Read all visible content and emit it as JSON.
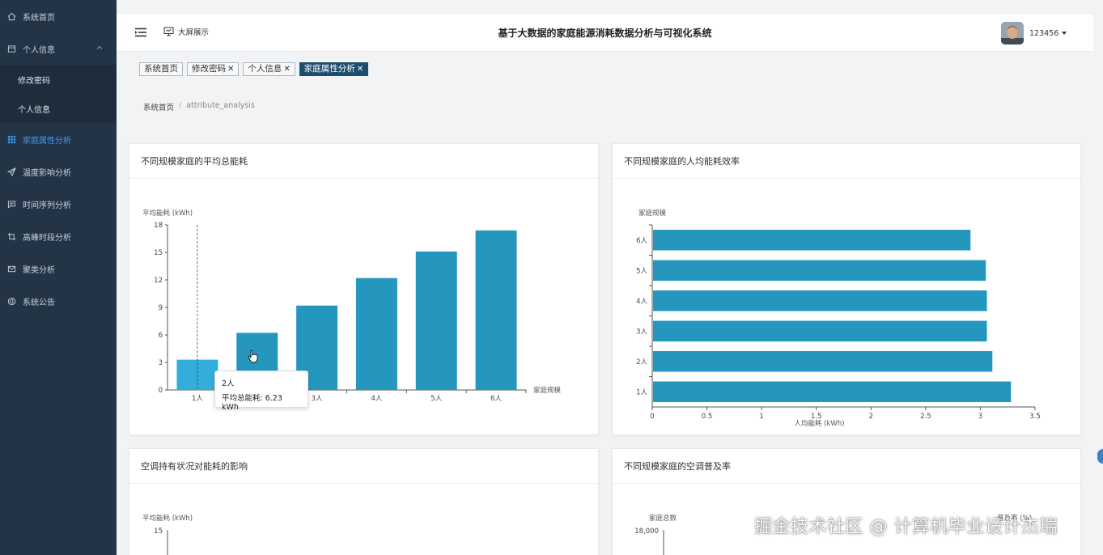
{
  "sidebar": {
    "items": [
      {
        "label": "系统首页",
        "icon": "home-icon"
      },
      {
        "label": "个人信息",
        "icon": "profile-icon",
        "expanded": true
      },
      {
        "label": "修改密码",
        "sub": true
      },
      {
        "label": "个人信息",
        "sub": true
      },
      {
        "label": "家庭属性分析",
        "icon": "grid-icon",
        "active": true
      },
      {
        "label": "温度影响分析",
        "icon": "send-icon"
      },
      {
        "label": "时间序列分析",
        "icon": "message-icon"
      },
      {
        "label": "高峰时段分析",
        "icon": "crop-icon"
      },
      {
        "label": "聚类分析",
        "icon": "mail-icon"
      },
      {
        "label": "系统公告",
        "icon": "announce-icon"
      }
    ]
  },
  "header": {
    "bigscreen_label": "大屏展示",
    "title": "基于大数据的家庭能源消耗数据分析与可视化系统",
    "username": "123456"
  },
  "tags": [
    {
      "label": "系统首页",
      "closable": false,
      "active": false
    },
    {
      "label": "修改密码",
      "closable": true,
      "active": false
    },
    {
      "label": "个人信息",
      "closable": true,
      "active": false
    },
    {
      "label": "家庭属性分析",
      "closable": true,
      "active": true
    }
  ],
  "breadcrumb": {
    "home": "系统首页",
    "sep": "/",
    "current": "attribute_analysis"
  },
  "cards": {
    "c1_title": "不同规模家庭的平均总能耗",
    "c2_title": "不同规模家庭的人均能耗效率",
    "c3_title": "空调持有状况对能耗的影响",
    "c4_title": "不同规模家庭的空调普及率"
  },
  "tooltip": {
    "category": "2人",
    "text": "平均总能耗: 6.23 kWh"
  },
  "watermark": "掘金技术社区 @ 计算机毕业设计杰瑞",
  "colors": {
    "bar": "#2596be",
    "bar_highlight": "#33aedb",
    "sidebar": "#243447",
    "active_tag": "#1d4d6c",
    "accent": "#3d9bf0"
  },
  "chart_data": [
    {
      "type": "bar",
      "title": "不同规模家庭的平均总能耗",
      "categories": [
        "1人",
        "2人",
        "3人",
        "4人",
        "5人",
        "6人"
      ],
      "values": [
        3.3,
        6.23,
        9.2,
        12.2,
        15.1,
        17.4
      ],
      "ylabel": "平均能耗 (kWh)",
      "xlabel": "家庭规模",
      "ylim": [
        0,
        18
      ],
      "yticks": [
        0,
        3,
        6,
        9,
        12,
        15,
        18
      ],
      "highlight_index": 0
    },
    {
      "type": "bar",
      "orientation": "horizontal",
      "title": "不同规模家庭的人均能耗效率",
      "categories": [
        "1人",
        "2人",
        "3人",
        "4人",
        "5人",
        "6人"
      ],
      "values": [
        3.28,
        3.11,
        3.06,
        3.06,
        3.05,
        2.91
      ],
      "ylabel": "家庭规模",
      "xlabel": "人均能耗 (kWh)",
      "xlim": [
        0,
        3.5
      ],
      "xticks": [
        "0",
        "0.5",
        "1",
        "1.5",
        "2",
        "2.5",
        "3",
        "3.5"
      ]
    },
    {
      "type": "bar",
      "title": "空调持有状况对能耗的影响",
      "ylabel": "平均能耗 (kWh)",
      "yticks_visible": [
        "15"
      ]
    },
    {
      "type": "bar",
      "title": "不同规模家庭的空调普及率",
      "ylabel": "家庭总数",
      "ylabel_right": "普及率 (%)",
      "yticks_visible": [
        "18,000"
      ]
    }
  ]
}
